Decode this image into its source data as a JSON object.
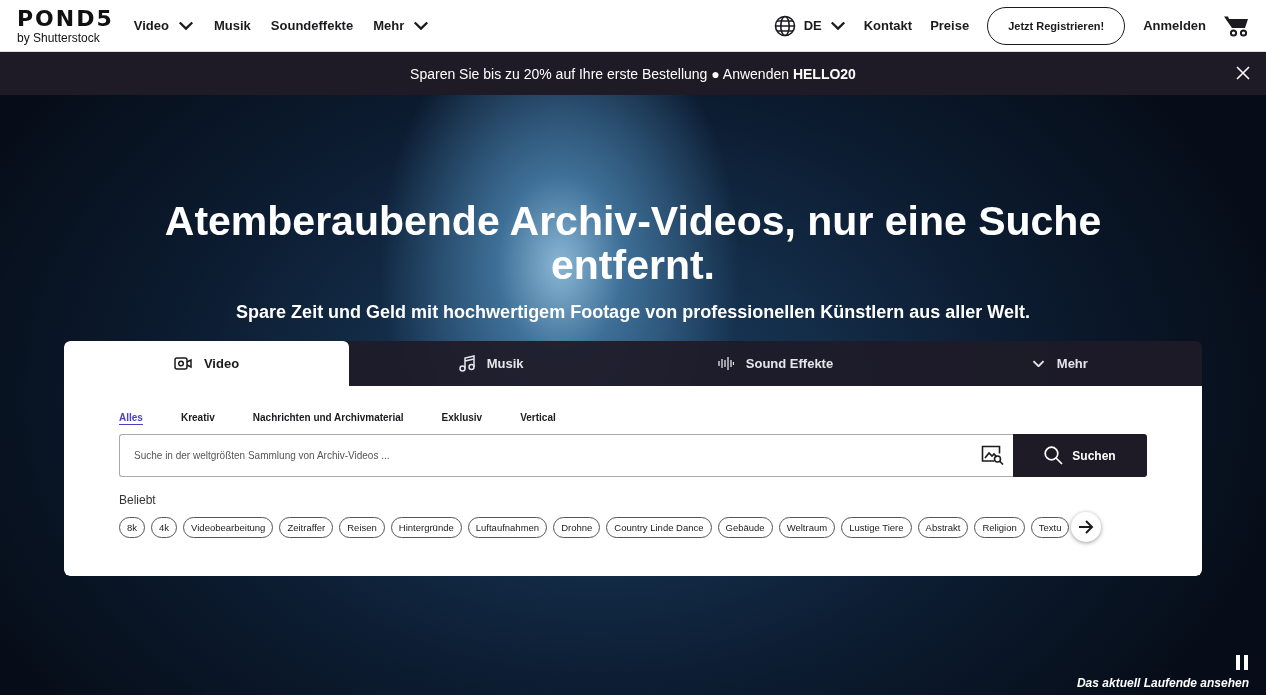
{
  "header": {
    "logo": {
      "wordmark": "POND5",
      "byline": "by Shutterstock"
    },
    "nav": [
      {
        "label": "Video",
        "dropdown": true
      },
      {
        "label": "Musik",
        "dropdown": false
      },
      {
        "label": "Soundeffekte",
        "dropdown": false
      },
      {
        "label": "Mehr",
        "dropdown": true
      }
    ],
    "language": {
      "code": "DE",
      "dropdown": true
    },
    "links": [
      "Kontakt",
      "Preise"
    ],
    "register_button": "Jetzt Registrieren!",
    "login": "Anmelden"
  },
  "promo_bar": {
    "text": "Sparen Sie bis zu 20% auf Ihre erste Bestellung ● Anwenden **HELLO20**",
    "closable": true
  },
  "hero": {
    "headline": "Atemberaubende Archiv-Videos, nur eine Suche entfernt.",
    "subheadline": "Spare Zeit und Geld mit hochwertigem Footage von professionellen Künstlern aus aller Welt."
  },
  "search_card": {
    "tabs": [
      {
        "label": "Video",
        "kind": "video",
        "selected": true
      },
      {
        "label": "Musik",
        "kind": "music",
        "selected": false
      },
      {
        "label": "Sound Effekte",
        "kind": "sound",
        "selected": false
      },
      {
        "label": "Mehr",
        "kind": "more",
        "selected": false
      }
    ],
    "filters": [
      {
        "label": "Alles",
        "selected": true
      },
      {
        "label": "Kreativ",
        "selected": false
      },
      {
        "label": "Nachrichten und Archivmaterial",
        "selected": false
      },
      {
        "label": "Exklusiv",
        "selected": false
      },
      {
        "label": "Vertical",
        "selected": false
      }
    ],
    "search": {
      "placeholder": "Suche in der weltgrößten Sammlung von Archiv-Videos ..."
    },
    "search_button": "Suchen",
    "popular_label": "Beliebt",
    "chips": [
      "8k",
      "4k",
      "Videobearbeitung",
      "Zeitraffer",
      "Reisen",
      "Hintergründe",
      "Luftaufnahmen",
      "Drohne",
      "Country Linde Dance",
      "Gebäude",
      "Weltraum",
      "Lustige Tiere",
      "Abstrakt",
      "Religion",
      "Textu"
    ]
  },
  "video_control": {
    "playing": true,
    "caption": "Das aktuell Laufende ansehen"
  }
}
